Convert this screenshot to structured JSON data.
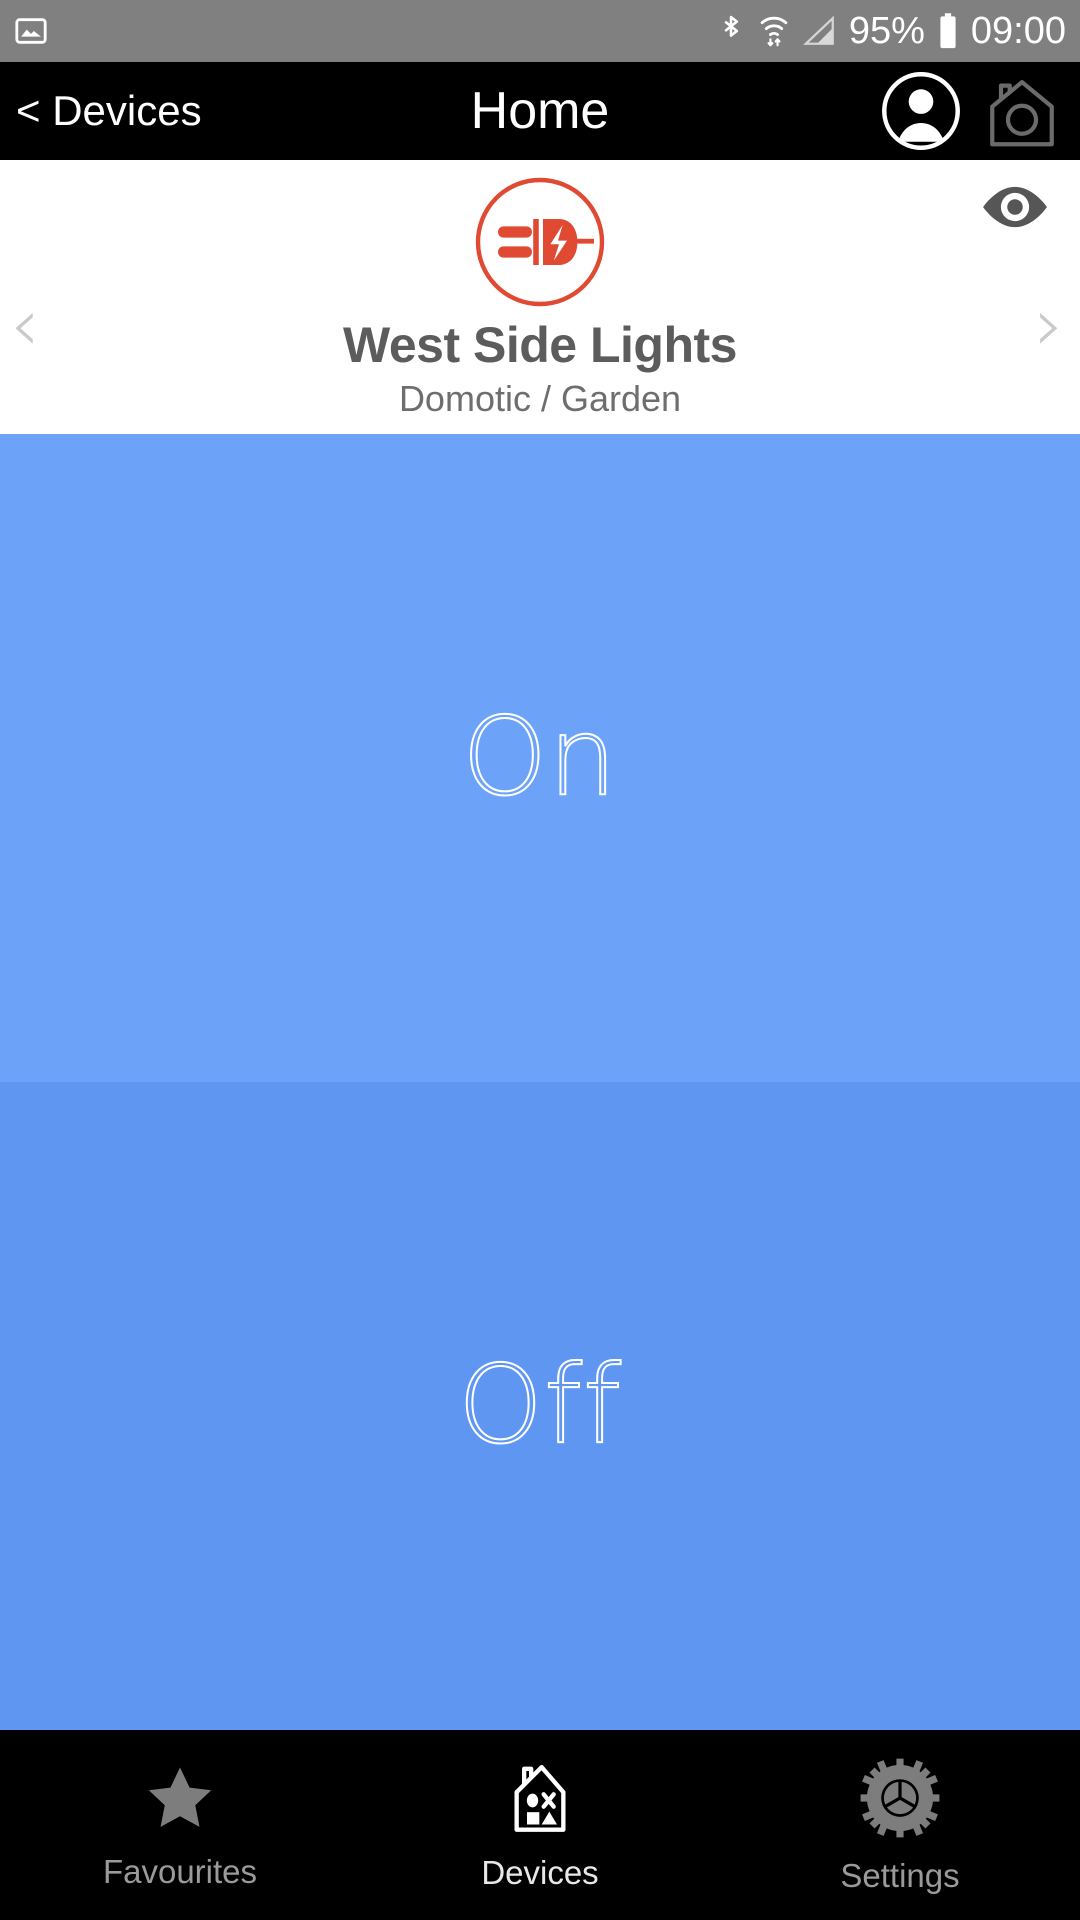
{
  "statusbar": {
    "left_icon": "screenshot-icon",
    "bluetooth_icon": "bluetooth-icon",
    "wifi_icon": "wifi-icon",
    "signal_icon": "cellular-signal-icon",
    "battery_percent": "95%",
    "battery_icon": "battery-icon",
    "clock": "09:00"
  },
  "navbar": {
    "back_label": "< Devices",
    "title": "Home",
    "profile_icon": "user-avatar-icon",
    "home_camera_icon": "house-camera-icon"
  },
  "device": {
    "icon": "power-plug-icon",
    "icon_color": "#e04a32",
    "name": "West Side Lights",
    "location": "Domotic / Garden",
    "visibility_icon": "eye-icon",
    "prev_icon": "chevron-left-icon",
    "next_icon": "chevron-right-icon",
    "prev_glyph": "‹",
    "next_glyph": "›"
  },
  "states": {
    "on_label": "On",
    "off_label": "Off",
    "on_color": "#6ca3f8",
    "off_color": "#5e96f1"
  },
  "tabbar": {
    "items": [
      {
        "label": "Favourites",
        "icon": "star-icon",
        "active": false
      },
      {
        "label": "Devices",
        "icon": "house-devices-icon",
        "active": true
      },
      {
        "label": "Settings",
        "icon": "gear-icon",
        "active": false
      }
    ]
  }
}
